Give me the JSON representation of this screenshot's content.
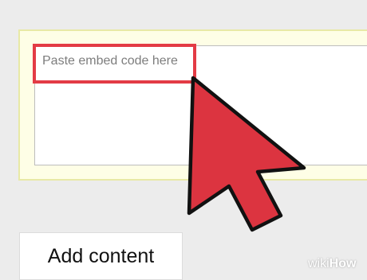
{
  "embed": {
    "placeholder": "Paste embed code here",
    "value": ""
  },
  "actions": {
    "add_content_label": "Add content"
  },
  "watermark": {
    "prefix": "wiki",
    "suffix": "How"
  },
  "colors": {
    "highlight": "#e33b45",
    "cursor_fill": "#dc3440",
    "panel_bg": "#fefee6",
    "panel_border": "#e8e9a6"
  },
  "icons": {
    "cursor": "mouse-pointer-arrow-icon"
  }
}
